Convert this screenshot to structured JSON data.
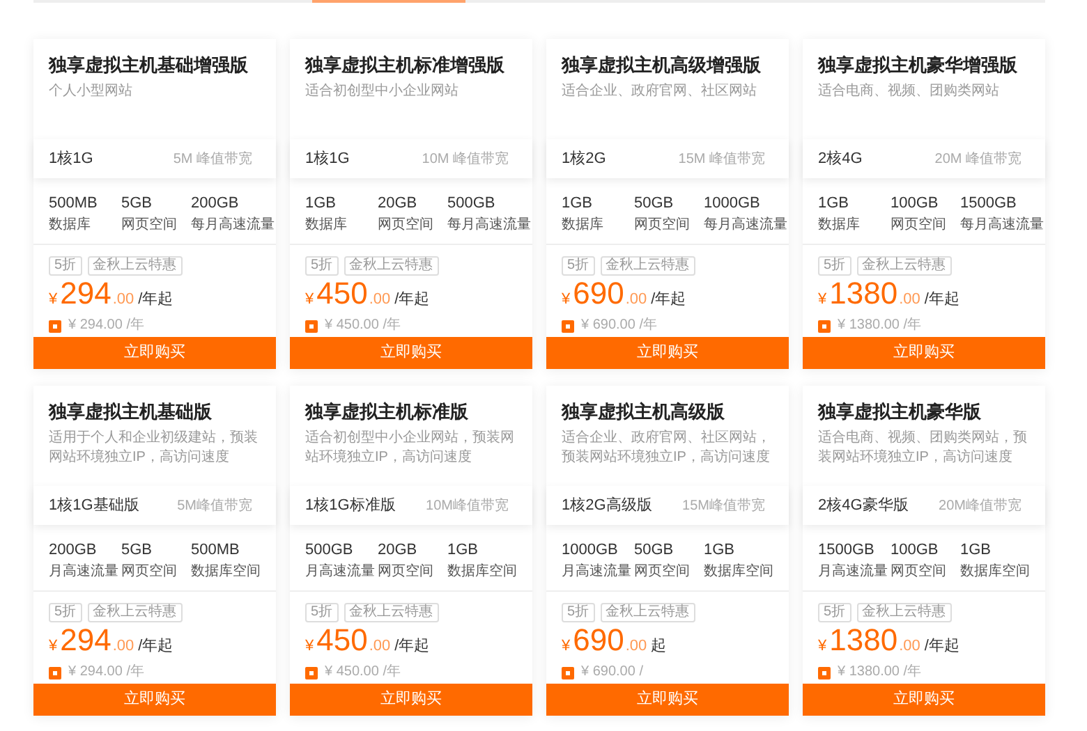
{
  "plans": [
    {
      "title": "独享虚拟主机基础增强版",
      "description": "个人小型网站",
      "spec": "1核1G",
      "bandwidth": "5M 峰值带宽",
      "stats": [
        {
          "value": "500MB",
          "label": "数据库"
        },
        {
          "value": "5GB",
          "label": "网页空间"
        },
        {
          "value": "200GB",
          "label": "每月高速流量"
        }
      ],
      "tags": [
        "5折",
        "金秋上云特惠"
      ],
      "currency": "¥",
      "price": "294",
      "price_decimal": ".00",
      "price_unit": "/年起",
      "original_price": "¥ 294.00 /年",
      "button": "立即购买"
    },
    {
      "title": "独享虚拟主机标准增强版",
      "description": "适合初创型中小企业网站",
      "spec": "1核1G",
      "bandwidth": "10M 峰值带宽",
      "stats": [
        {
          "value": "1GB",
          "label": "数据库"
        },
        {
          "value": "20GB",
          "label": "网页空间"
        },
        {
          "value": "500GB",
          "label": "每月高速流量"
        }
      ],
      "tags": [
        "5折",
        "金秋上云特惠"
      ],
      "currency": "¥",
      "price": "450",
      "price_decimal": ".00",
      "price_unit": "/年起",
      "original_price": "¥ 450.00 /年",
      "button": "立即购买"
    },
    {
      "title": "独享虚拟主机高级增强版",
      "description": "适合企业、政府官网、社区网站",
      "spec": "1核2G",
      "bandwidth": "15M 峰值带宽",
      "stats": [
        {
          "value": "1GB",
          "label": "数据库"
        },
        {
          "value": "50GB",
          "label": "网页空间"
        },
        {
          "value": "1000GB",
          "label": "每月高速流量"
        }
      ],
      "tags": [
        "5折",
        "金秋上云特惠"
      ],
      "currency": "¥",
      "price": "690",
      "price_decimal": ".00",
      "price_unit": "/年起",
      "original_price": "¥ 690.00 /年",
      "button": "立即购买"
    },
    {
      "title": "独享虚拟主机豪华增强版",
      "description": "适合电商、视频、团购类网站",
      "spec": "2核4G",
      "bandwidth": "20M 峰值带宽",
      "stats": [
        {
          "value": "1GB",
          "label": "数据库"
        },
        {
          "value": "100GB",
          "label": "网页空间"
        },
        {
          "value": "1500GB",
          "label": "每月高速流量"
        }
      ],
      "tags": [
        "5折",
        "金秋上云特惠"
      ],
      "currency": "¥",
      "price": "1380",
      "price_decimal": ".00",
      "price_unit": "/年起",
      "original_price": "¥ 1380.00 /年",
      "button": "立即购买"
    },
    {
      "title": "独享虚拟主机基础版",
      "description": "适用于个人和企业初级建站，预装网站环境独立IP，高访问速度",
      "spec": "1核1G基础版",
      "bandwidth": "5M峰值带宽",
      "stats": [
        {
          "value": "200GB",
          "label": "月高速流量"
        },
        {
          "value": "5GB",
          "label": "网页空间"
        },
        {
          "value": "500MB",
          "label": "数据库空间"
        }
      ],
      "tags": [
        "5折",
        "金秋上云特惠"
      ],
      "currency": "¥",
      "price": "294",
      "price_decimal": ".00",
      "price_unit": "/年起",
      "original_price": "¥ 294.00 /年",
      "button": "立即购买"
    },
    {
      "title": "独享虚拟主机标准版",
      "description": "适合初创型中小企业网站，预装网站环境独立IP，高访问速度",
      "spec": "1核1G标准版",
      "bandwidth": "10M峰值带宽",
      "stats": [
        {
          "value": "500GB",
          "label": "月高速流量"
        },
        {
          "value": "20GB",
          "label": "网页空间"
        },
        {
          "value": "1GB",
          "label": "数据库空间"
        }
      ],
      "tags": [
        "5折",
        "金秋上云特惠"
      ],
      "currency": "¥",
      "price": "450",
      "price_decimal": ".00",
      "price_unit": "/年起",
      "original_price": "¥ 450.00 /年",
      "button": "立即购买"
    },
    {
      "title": "独享虚拟主机高级版",
      "description": "适合企业、政府官网、社区网站，预装网站环境独立IP，高访问速度",
      "spec": "1核2G高级版",
      "bandwidth": "15M峰值带宽",
      "stats": [
        {
          "value": "1000GB",
          "label": "月高速流量"
        },
        {
          "value": "50GB",
          "label": "网页空间"
        },
        {
          "value": "1GB",
          "label": "数据库空间"
        }
      ],
      "tags": [
        "5折",
        "金秋上云特惠"
      ],
      "currency": "¥",
      "price": "690",
      "price_decimal": ".00",
      "price_unit": "起",
      "original_price": "¥ 690.00 /",
      "button": "立即购买"
    },
    {
      "title": "独享虚拟主机豪华版",
      "description": "适合电商、视频、团购类网站，预装网站环境独立IP，高访问速度",
      "spec": "2核4G豪华版",
      "bandwidth": "20M峰值带宽",
      "stats": [
        {
          "value": "1500GB",
          "label": "月高速流量"
        },
        {
          "value": "100GB",
          "label": "网页空间"
        },
        {
          "value": "1GB",
          "label": "数据库空间"
        }
      ],
      "tags": [
        "5折",
        "金秋上云特惠"
      ],
      "currency": "¥",
      "price": "1380",
      "price_decimal": ".00",
      "price_unit": "/年起",
      "original_price": "¥ 1380.00 /年",
      "button": "立即购买"
    }
  ]
}
